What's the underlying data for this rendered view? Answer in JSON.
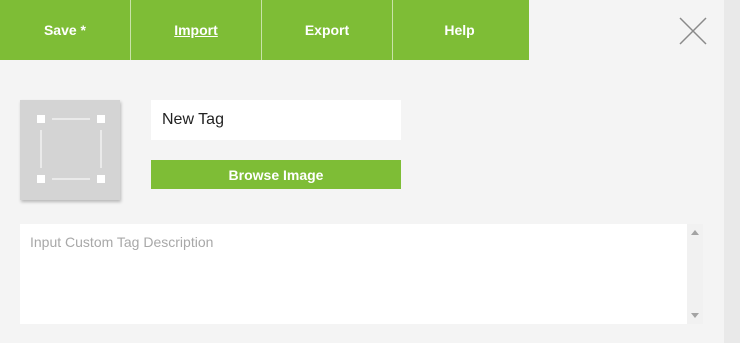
{
  "toolbar": {
    "save_label": "Save *",
    "import_label": "Import",
    "export_label": "Export",
    "help_label": "Help"
  },
  "tag": {
    "name_value": "New Tag",
    "browse_label": "Browse Image",
    "description_placeholder": "Input Custom Tag Description",
    "description_value": ""
  },
  "colors": {
    "accent": "#7ebd36",
    "background": "#f4f4f4"
  },
  "icons": {
    "close": "close-icon",
    "image_placeholder": "image-placeholder-icon"
  }
}
